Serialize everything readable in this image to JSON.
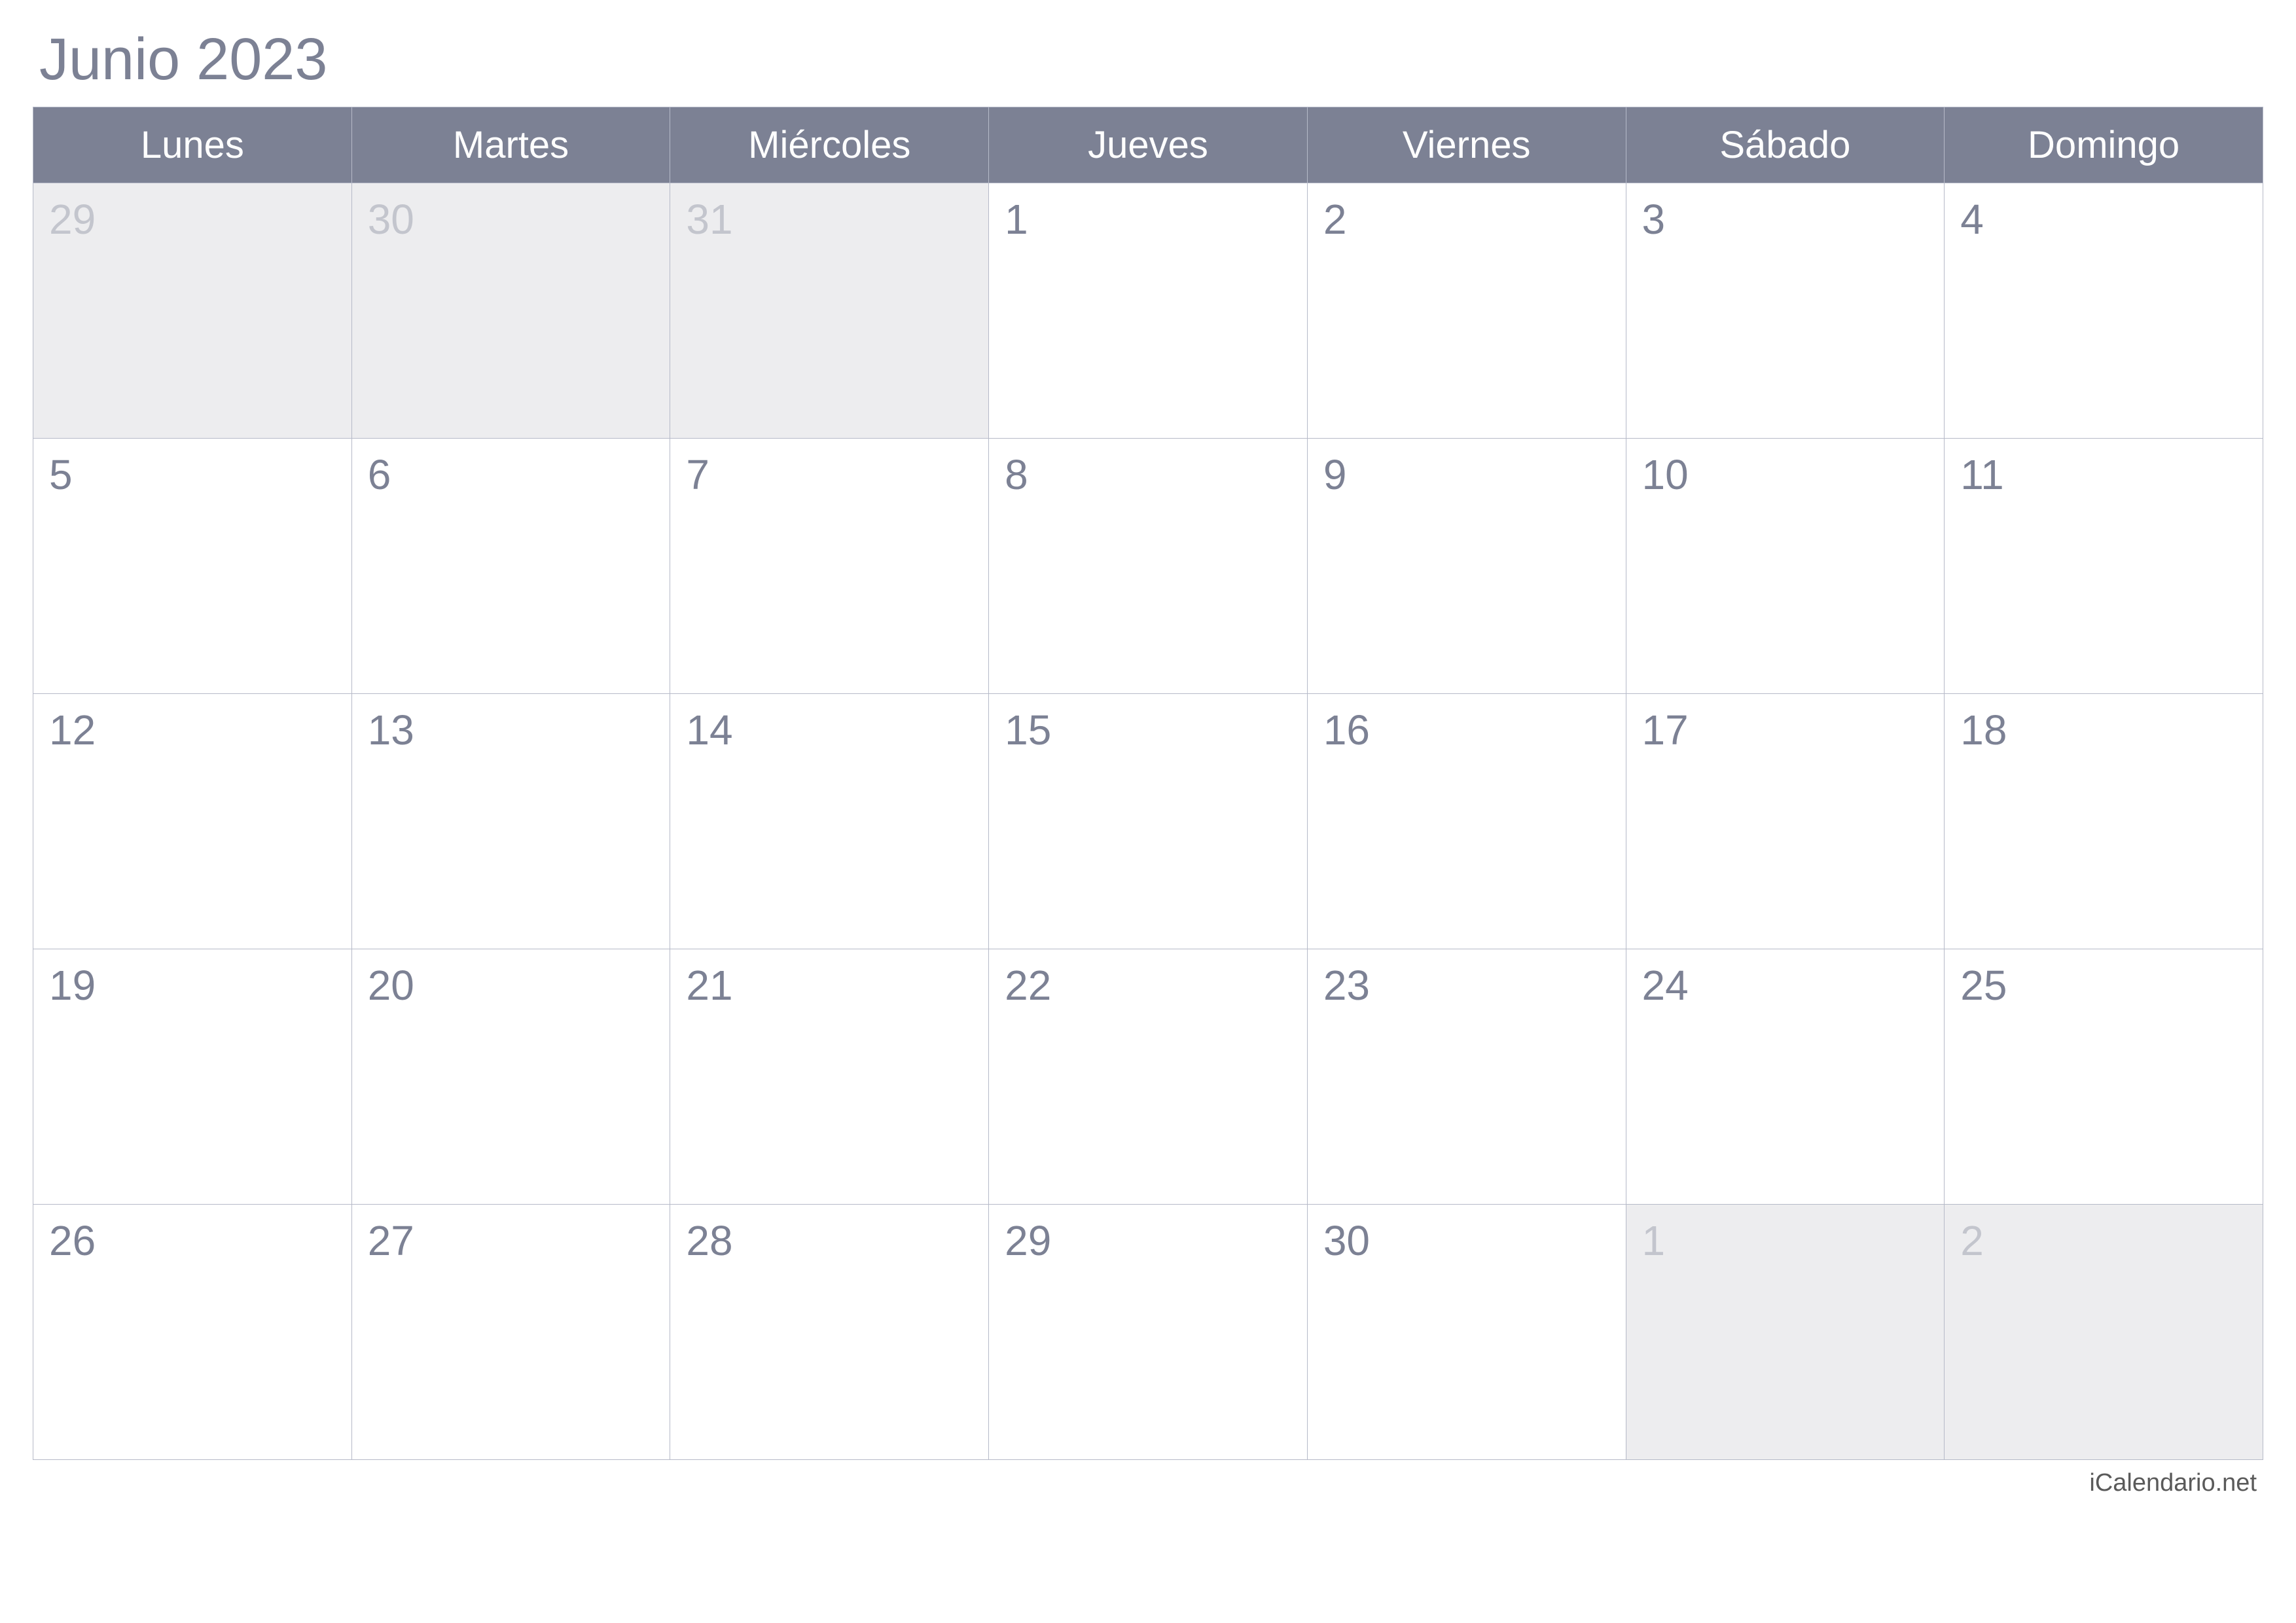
{
  "title": "Junio 2023",
  "weekdays": [
    "Lunes",
    "Martes",
    "Miércoles",
    "Jueves",
    "Viernes",
    "Sábado",
    "Domingo"
  ],
  "weeks": [
    [
      {
        "n": "29",
        "out": true
      },
      {
        "n": "30",
        "out": true
      },
      {
        "n": "31",
        "out": true
      },
      {
        "n": "1",
        "out": false
      },
      {
        "n": "2",
        "out": false
      },
      {
        "n": "3",
        "out": false
      },
      {
        "n": "4",
        "out": false
      }
    ],
    [
      {
        "n": "5",
        "out": false
      },
      {
        "n": "6",
        "out": false
      },
      {
        "n": "7",
        "out": false
      },
      {
        "n": "8",
        "out": false
      },
      {
        "n": "9",
        "out": false
      },
      {
        "n": "10",
        "out": false
      },
      {
        "n": "11",
        "out": false
      }
    ],
    [
      {
        "n": "12",
        "out": false
      },
      {
        "n": "13",
        "out": false
      },
      {
        "n": "14",
        "out": false
      },
      {
        "n": "15",
        "out": false
      },
      {
        "n": "16",
        "out": false
      },
      {
        "n": "17",
        "out": false
      },
      {
        "n": "18",
        "out": false
      }
    ],
    [
      {
        "n": "19",
        "out": false
      },
      {
        "n": "20",
        "out": false
      },
      {
        "n": "21",
        "out": false
      },
      {
        "n": "22",
        "out": false
      },
      {
        "n": "23",
        "out": false
      },
      {
        "n": "24",
        "out": false
      },
      {
        "n": "25",
        "out": false
      }
    ],
    [
      {
        "n": "26",
        "out": false
      },
      {
        "n": "27",
        "out": false
      },
      {
        "n": "28",
        "out": false
      },
      {
        "n": "29",
        "out": false
      },
      {
        "n": "30",
        "out": false
      },
      {
        "n": "1",
        "out": true
      },
      {
        "n": "2",
        "out": true
      }
    ]
  ],
  "footer": "iCalendario.net"
}
